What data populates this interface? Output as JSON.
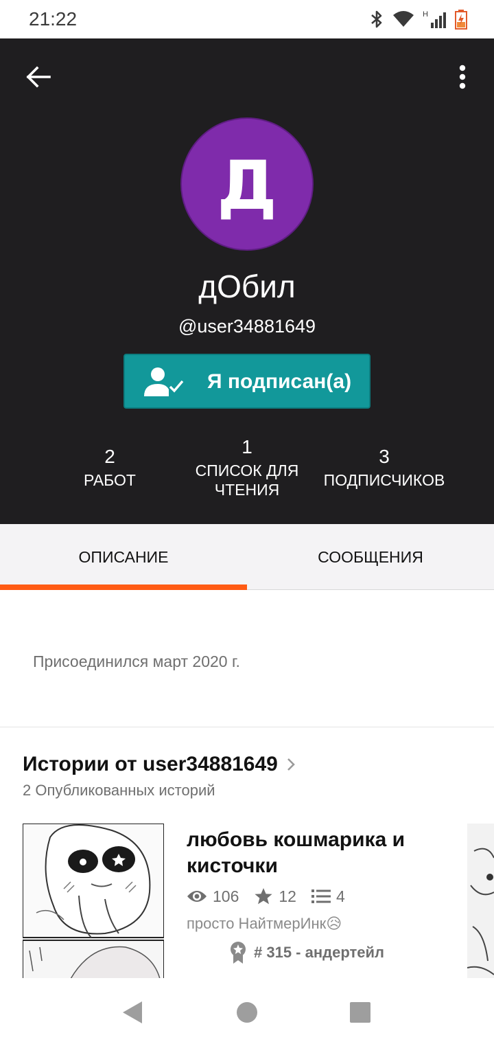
{
  "status_bar": {
    "time": "21:22",
    "network_label": "H"
  },
  "profile": {
    "avatar_letter": "Д",
    "display_name": "дОбил",
    "username": "@user34881649",
    "follow_label": "Я подписан(а)"
  },
  "stats": [
    {
      "value": "2",
      "label": "РАБОТ"
    },
    {
      "value": "1",
      "label": "СПИСОК ДЛЯ ЧТЕНИЯ"
    },
    {
      "value": "3",
      "label": "ПОДПИСЧИКОВ"
    }
  ],
  "tabs": [
    {
      "label": "ОПИСАНИЕ",
      "active": true
    },
    {
      "label": "СООБЩЕНИЯ",
      "active": false
    }
  ],
  "about": {
    "joined": "Присоединился март 2020 г."
  },
  "stories": {
    "title": "Истории от user34881649",
    "subtitle": "2 Опубликованных историй",
    "items": [
      {
        "title": "любовь кошмарика и кисточки",
        "reads": "106",
        "votes": "12",
        "parts": "4",
        "description": "просто НайтмерИнк😥",
        "rank": "# 315 - андертейл"
      }
    ]
  },
  "colors": {
    "header_bg": "#1f1e20",
    "avatar_bg": "#7f2bab",
    "follow_bg": "#12989a",
    "tab_indicator": "#ff5b14"
  },
  "icons": {
    "back": "arrow-left-icon",
    "more": "more-vert-icon",
    "follow": "person-check-icon",
    "reads": "eye-icon",
    "votes": "star-icon",
    "parts": "list-icon",
    "rank": "award-badge-icon",
    "chevron": "chevron-right-icon"
  }
}
